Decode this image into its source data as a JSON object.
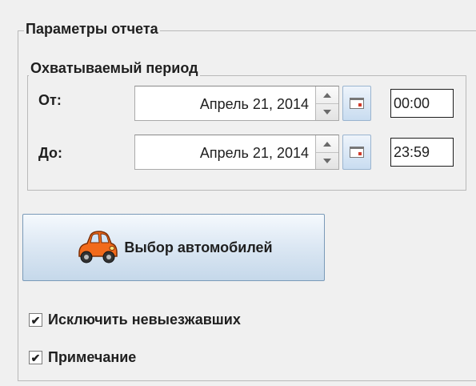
{
  "report_params": {
    "title": "Параметры отчета",
    "period": {
      "title": "Охватываемый период",
      "from": {
        "label": "От:",
        "date": "Апрель 21, 2014",
        "time": "00:00"
      },
      "to": {
        "label": "До:",
        "date": "Апрель 21, 2014",
        "time": "23:59"
      }
    },
    "select_cars_label": "Выбор автомобилей",
    "checkboxes": [
      {
        "label": "Исключить невыезжавших",
        "checked": true,
        "mark": "✔"
      },
      {
        "label": "Примечание",
        "checked": true,
        "mark": "✔"
      }
    ]
  },
  "icons": {
    "spinner_up": "triangle-up",
    "spinner_down": "triangle-down",
    "calendar": "calendar-icon",
    "car": "car-icon"
  },
  "colors": {
    "background": "#f0f0f0",
    "button_gradient_top": "#f5f9fd",
    "button_gradient_bottom": "#c5d8ea",
    "car": "#f26a1b"
  }
}
